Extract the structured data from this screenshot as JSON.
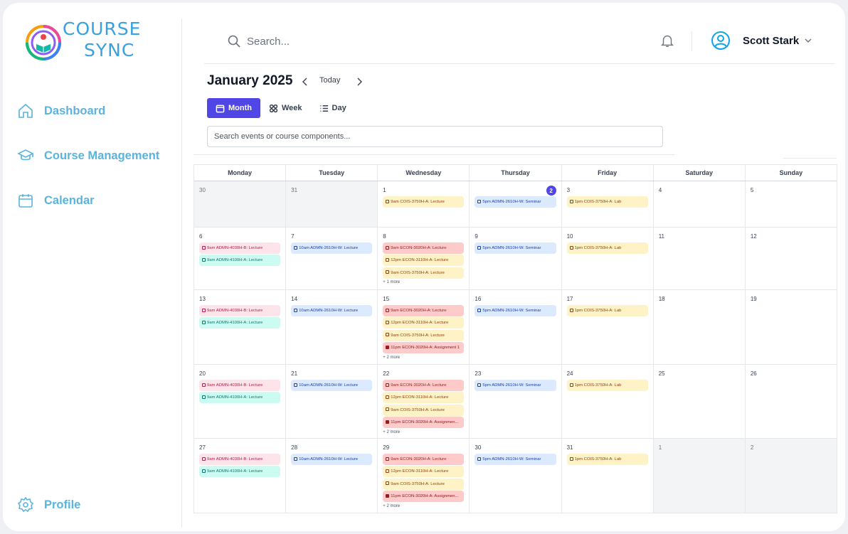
{
  "logo": {
    "line1": "COURSE",
    "line2": "SYNC"
  },
  "sidebar": {
    "items": [
      {
        "label": "Dashboard",
        "icon": "home-icon"
      },
      {
        "label": "Course Management",
        "icon": "graduation-cap-icon"
      },
      {
        "label": "Calendar",
        "icon": "calendar-icon"
      }
    ],
    "profile_label": "Profile"
  },
  "header": {
    "search_placeholder": "Search...",
    "user_name": "Scott Stark"
  },
  "calendar": {
    "month_title": "January 2025",
    "today_label": "Today",
    "views": [
      {
        "label": "Month",
        "active": true
      },
      {
        "label": "Week",
        "active": false
      },
      {
        "label": "Day",
        "active": false
      }
    ],
    "search_placeholder": "Search events or course components...",
    "weekdays": [
      "Monday",
      "Tuesday",
      "Wednesday",
      "Thursday",
      "Friday",
      "Saturday",
      "Sunday"
    ],
    "weeks": [
      [
        {
          "num": "30",
          "other": true,
          "events": []
        },
        {
          "num": "31",
          "other": true,
          "events": []
        },
        {
          "num": "1",
          "events": [
            {
              "text": "9am COIS-3750H-A: Lecture",
              "color": "yellow"
            }
          ]
        },
        {
          "num": "2",
          "today": true,
          "events": [
            {
              "text": "5pm ADMN-2610H-W: Seminar",
              "color": "blue"
            }
          ]
        },
        {
          "num": "3",
          "events": [
            {
              "text": "1pm COIS-3750H-A: Lab",
              "color": "yellow"
            }
          ]
        },
        {
          "num": "4",
          "events": []
        },
        {
          "num": "5",
          "events": []
        }
      ],
      [
        {
          "num": "6",
          "events": [
            {
              "text": "9am ADMN-4030H-B: Lecture",
              "color": "pink"
            },
            {
              "text": "9am ADMN-4100H-A: Lecture",
              "color": "teal"
            }
          ]
        },
        {
          "num": "7",
          "events": [
            {
              "text": "10am ADMN-2610H-W: Lecture",
              "color": "blue"
            }
          ]
        },
        {
          "num": "8",
          "events": [
            {
              "text": "9am ECON-3020H-A: Lecture",
              "color": "salmon"
            },
            {
              "text": "12pm ECON-3110H-A: Lecture",
              "color": "yellow"
            },
            {
              "text": "9am COIS-3750H-A: Lecture",
              "color": "yellow"
            }
          ],
          "more": "+ 1 more"
        },
        {
          "num": "9",
          "events": [
            {
              "text": "5pm ADMN-2610H-W: Seminar",
              "color": "blue"
            }
          ]
        },
        {
          "num": "10",
          "events": [
            {
              "text": "1pm COIS-3750H-A: Lab",
              "color": "yellow"
            }
          ]
        },
        {
          "num": "11",
          "events": []
        },
        {
          "num": "12",
          "events": []
        }
      ],
      [
        {
          "num": "13",
          "events": [
            {
              "text": "9am ADMN-4030H-B: Lecture",
              "color": "pink"
            },
            {
              "text": "9am ADMN-4100H-A: Lecture",
              "color": "teal"
            }
          ]
        },
        {
          "num": "14",
          "events": [
            {
              "text": "10am ADMN-2610H-W: Lecture",
              "color": "blue"
            }
          ]
        },
        {
          "num": "15",
          "events": [
            {
              "text": "9am ECON-3020H-A: Lecture",
              "color": "salmon"
            },
            {
              "text": "12pm ECON-3110H-A: Lecture",
              "color": "yellow"
            },
            {
              "text": "9am COIS-3750H-A: Lecture",
              "color": "yellow"
            },
            {
              "text": "11pm ECON-3020H-A: Assignment 1",
              "color": "assign"
            }
          ],
          "more": "+ 2 more"
        },
        {
          "num": "16",
          "events": [
            {
              "text": "5pm ADMN-2610H-W: Seminar",
              "color": "blue"
            }
          ]
        },
        {
          "num": "17",
          "events": [
            {
              "text": "1pm COIS-3750H-A: Lab",
              "color": "yellow"
            }
          ]
        },
        {
          "num": "18",
          "events": []
        },
        {
          "num": "19",
          "events": []
        }
      ],
      [
        {
          "num": "20",
          "events": [
            {
              "text": "9am ADMN-4030H-B: Lecture",
              "color": "pink"
            },
            {
              "text": "9am ADMN-4100H-A: Lecture",
              "color": "teal"
            }
          ]
        },
        {
          "num": "21",
          "events": [
            {
              "text": "10am ADMN-2610H-W: Lecture",
              "color": "blue"
            }
          ]
        },
        {
          "num": "22",
          "events": [
            {
              "text": "9am ECON-3020H-A: Lecture",
              "color": "salmon"
            },
            {
              "text": "12pm ECON-3110H-A: Lecture",
              "color": "yellow"
            },
            {
              "text": "9am COIS-3750H-A: Lecture",
              "color": "yellow"
            },
            {
              "text": "11pm ECON-3020H-A: Assignmen...",
              "color": "assign"
            }
          ],
          "more": "+ 2 more"
        },
        {
          "num": "23",
          "events": [
            {
              "text": "5pm ADMN-2610H-W: Seminar",
              "color": "blue"
            }
          ]
        },
        {
          "num": "24",
          "events": [
            {
              "text": "1pm COIS-3750H-A: Lab",
              "color": "yellow"
            }
          ]
        },
        {
          "num": "25",
          "events": []
        },
        {
          "num": "26",
          "events": []
        }
      ],
      [
        {
          "num": "27",
          "events": [
            {
              "text": "9am ADMN-4030H-B: Lecture",
              "color": "pink"
            },
            {
              "text": "9am ADMN-4100H-A: Lecture",
              "color": "teal"
            }
          ]
        },
        {
          "num": "28",
          "events": [
            {
              "text": "10am ADMN-2610H-W: Lecture",
              "color": "blue"
            }
          ]
        },
        {
          "num": "29",
          "events": [
            {
              "text": "9am ECON-3020H-A: Lecture",
              "color": "salmon"
            },
            {
              "text": "12pm ECON-3110H-A: Lecture",
              "color": "yellow"
            },
            {
              "text": "9am COIS-3750H-A: Lecture",
              "color": "yellow"
            },
            {
              "text": "11pm ECON-3020H-A: Assignmen...",
              "color": "assign"
            }
          ],
          "more": "+ 2 more"
        },
        {
          "num": "30",
          "events": [
            {
              "text": "5pm ADMN-2610H-W: Seminar",
              "color": "blue"
            }
          ]
        },
        {
          "num": "31",
          "events": [
            {
              "text": "1pm COIS-3750H-A: Lab",
              "color": "yellow"
            }
          ]
        },
        {
          "num": "1",
          "other": true,
          "events": []
        },
        {
          "num": "2",
          "other": true,
          "events": []
        }
      ]
    ]
  },
  "colors": {
    "accent": "#4f46e5",
    "sidebar_text": "#5ab4dd",
    "logo_blue": "#3aa0e0"
  }
}
